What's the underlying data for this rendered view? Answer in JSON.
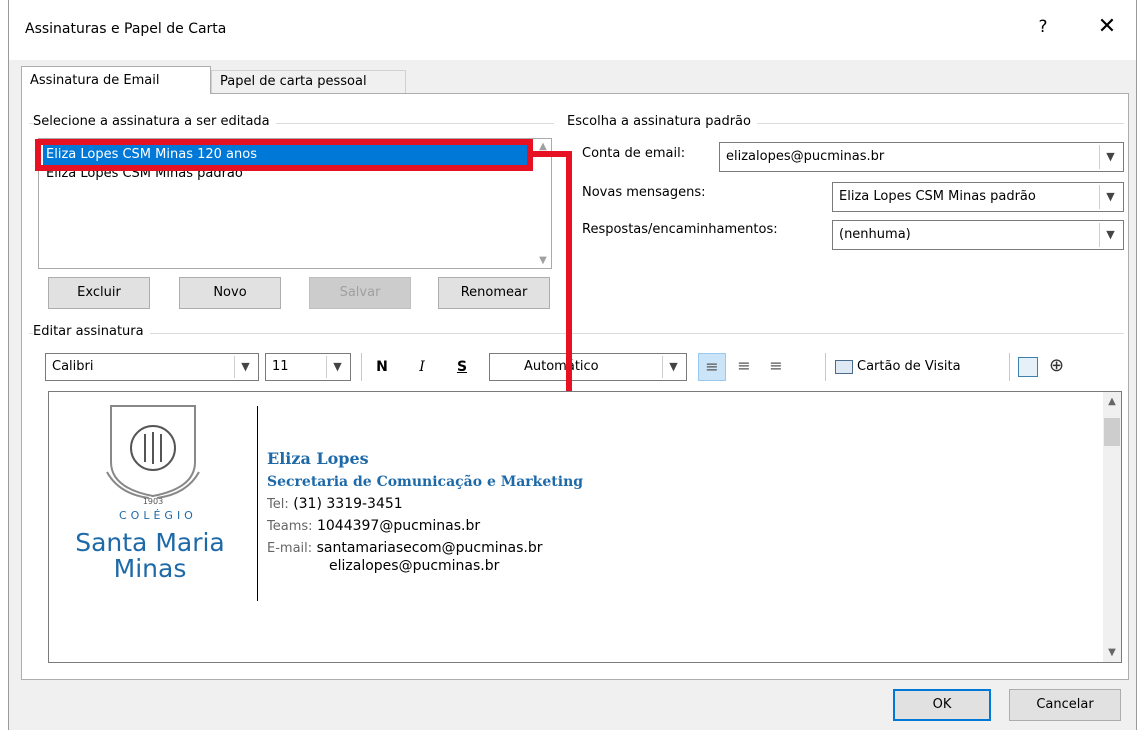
{
  "window": {
    "title": "Assinaturas e Papel de Carta",
    "help": "?",
    "close": "✕"
  },
  "tabs": [
    {
      "label": "Assinatura de Email",
      "active": true
    },
    {
      "label": "Papel de carta pessoal",
      "active": false
    }
  ],
  "select_group": {
    "label": "Selecione a assinatura a ser editada",
    "items": [
      "Eliza Lopes CSM Minas 120 anos",
      "Eliza Lopes CSM Minas padrão"
    ],
    "selected_index": 0,
    "buttons": {
      "delete": "Excluir",
      "new": "Novo",
      "save": "Salvar",
      "rename": "Renomear"
    }
  },
  "default_group": {
    "label": "Escolha a assinatura padrão",
    "account_label": "Conta de email:",
    "account_value": "elizalopes@pucminas.br",
    "new_label": "Novas mensagens:",
    "new_value": "Eliza Lopes CSM Minas padrão",
    "replies_label": "Respostas/encaminhamentos:",
    "replies_value": "(nenhuma)"
  },
  "edit_group": {
    "label": "Editar assinatura",
    "font": "Calibri",
    "size": "11",
    "bold": "N",
    "italic": "I",
    "strike": "S",
    "color": "Automático",
    "business_card": "Cartão de Visita"
  },
  "signature": {
    "logo_small": "1903",
    "logo_colegio": "COLÉGIO",
    "logo_line1": "Santa Maria",
    "logo_line2": "Minas",
    "name": "Eliza Lopes",
    "department": "Secretaria de Comunicação e Marketing",
    "tel_label": "Tel:",
    "tel_value": "(31) 3319-3451",
    "teams_label": "Teams:",
    "teams_value": "1044397@pucminas.br",
    "email_label": "E-mail:",
    "email_value1": "santamariasecom@pucminas.br",
    "email_value2": "elizalopes@pucminas.br"
  },
  "footer": {
    "ok": "OK",
    "cancel": "Cancelar"
  },
  "colors": {
    "accent": "#0078d7",
    "highlight": "#e81123",
    "brand_blue": "#1e6aa8"
  }
}
